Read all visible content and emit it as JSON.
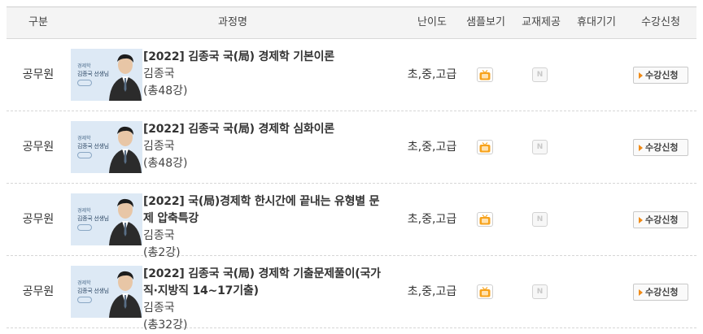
{
  "header": {
    "category": "구분",
    "course": "과정명",
    "level": "난이도",
    "sample": "샘플보기",
    "textbook": "교재제공",
    "mobile": "휴대기기",
    "apply": "수강신청"
  },
  "thumbnail": {
    "subject": "경제학",
    "teacher_name": "김종국 선생님"
  },
  "rows": [
    {
      "category": "공무원",
      "title": "[2022] 김종국 국(局) 경제학 기본이론",
      "teacher": "김종국",
      "lectures": "(총48강)",
      "level": "초,중,고급",
      "textbook_icon": "N",
      "apply_label": "수강신청"
    },
    {
      "category": "공무원",
      "title": "[2022] 김종국 국(局) 경제학 심화이론",
      "teacher": "김종국",
      "lectures": "(총48강)",
      "level": "초,중,고급",
      "textbook_icon": "N",
      "apply_label": "수강신청"
    },
    {
      "category": "공무원",
      "title": "[2022] 국(局)경제학 한시간에 끝내는 유형별 문제 압축특강",
      "teacher": "김종국",
      "lectures": "(총2강)",
      "level": "초,중,고급",
      "textbook_icon": "N",
      "apply_label": "수강신청"
    },
    {
      "category": "공무원",
      "title": "[2022] 김종국 국(局) 경제학 기출문제풀이(국가직·지방직 14~17기출)",
      "teacher": "김종국",
      "lectures": "(총32강)",
      "level": "초,중,고급",
      "textbook_icon": "N",
      "apply_label": "수강신청"
    }
  ],
  "icons": {
    "sample": "tv-icon",
    "textbook": "textbook-n-icon",
    "apply": "arrow-right-icon"
  },
  "colors": {
    "sample_icon": "#f7a21b",
    "apply_arrow": "#f08a16",
    "thumbnail_bg": "#dde9f5"
  }
}
